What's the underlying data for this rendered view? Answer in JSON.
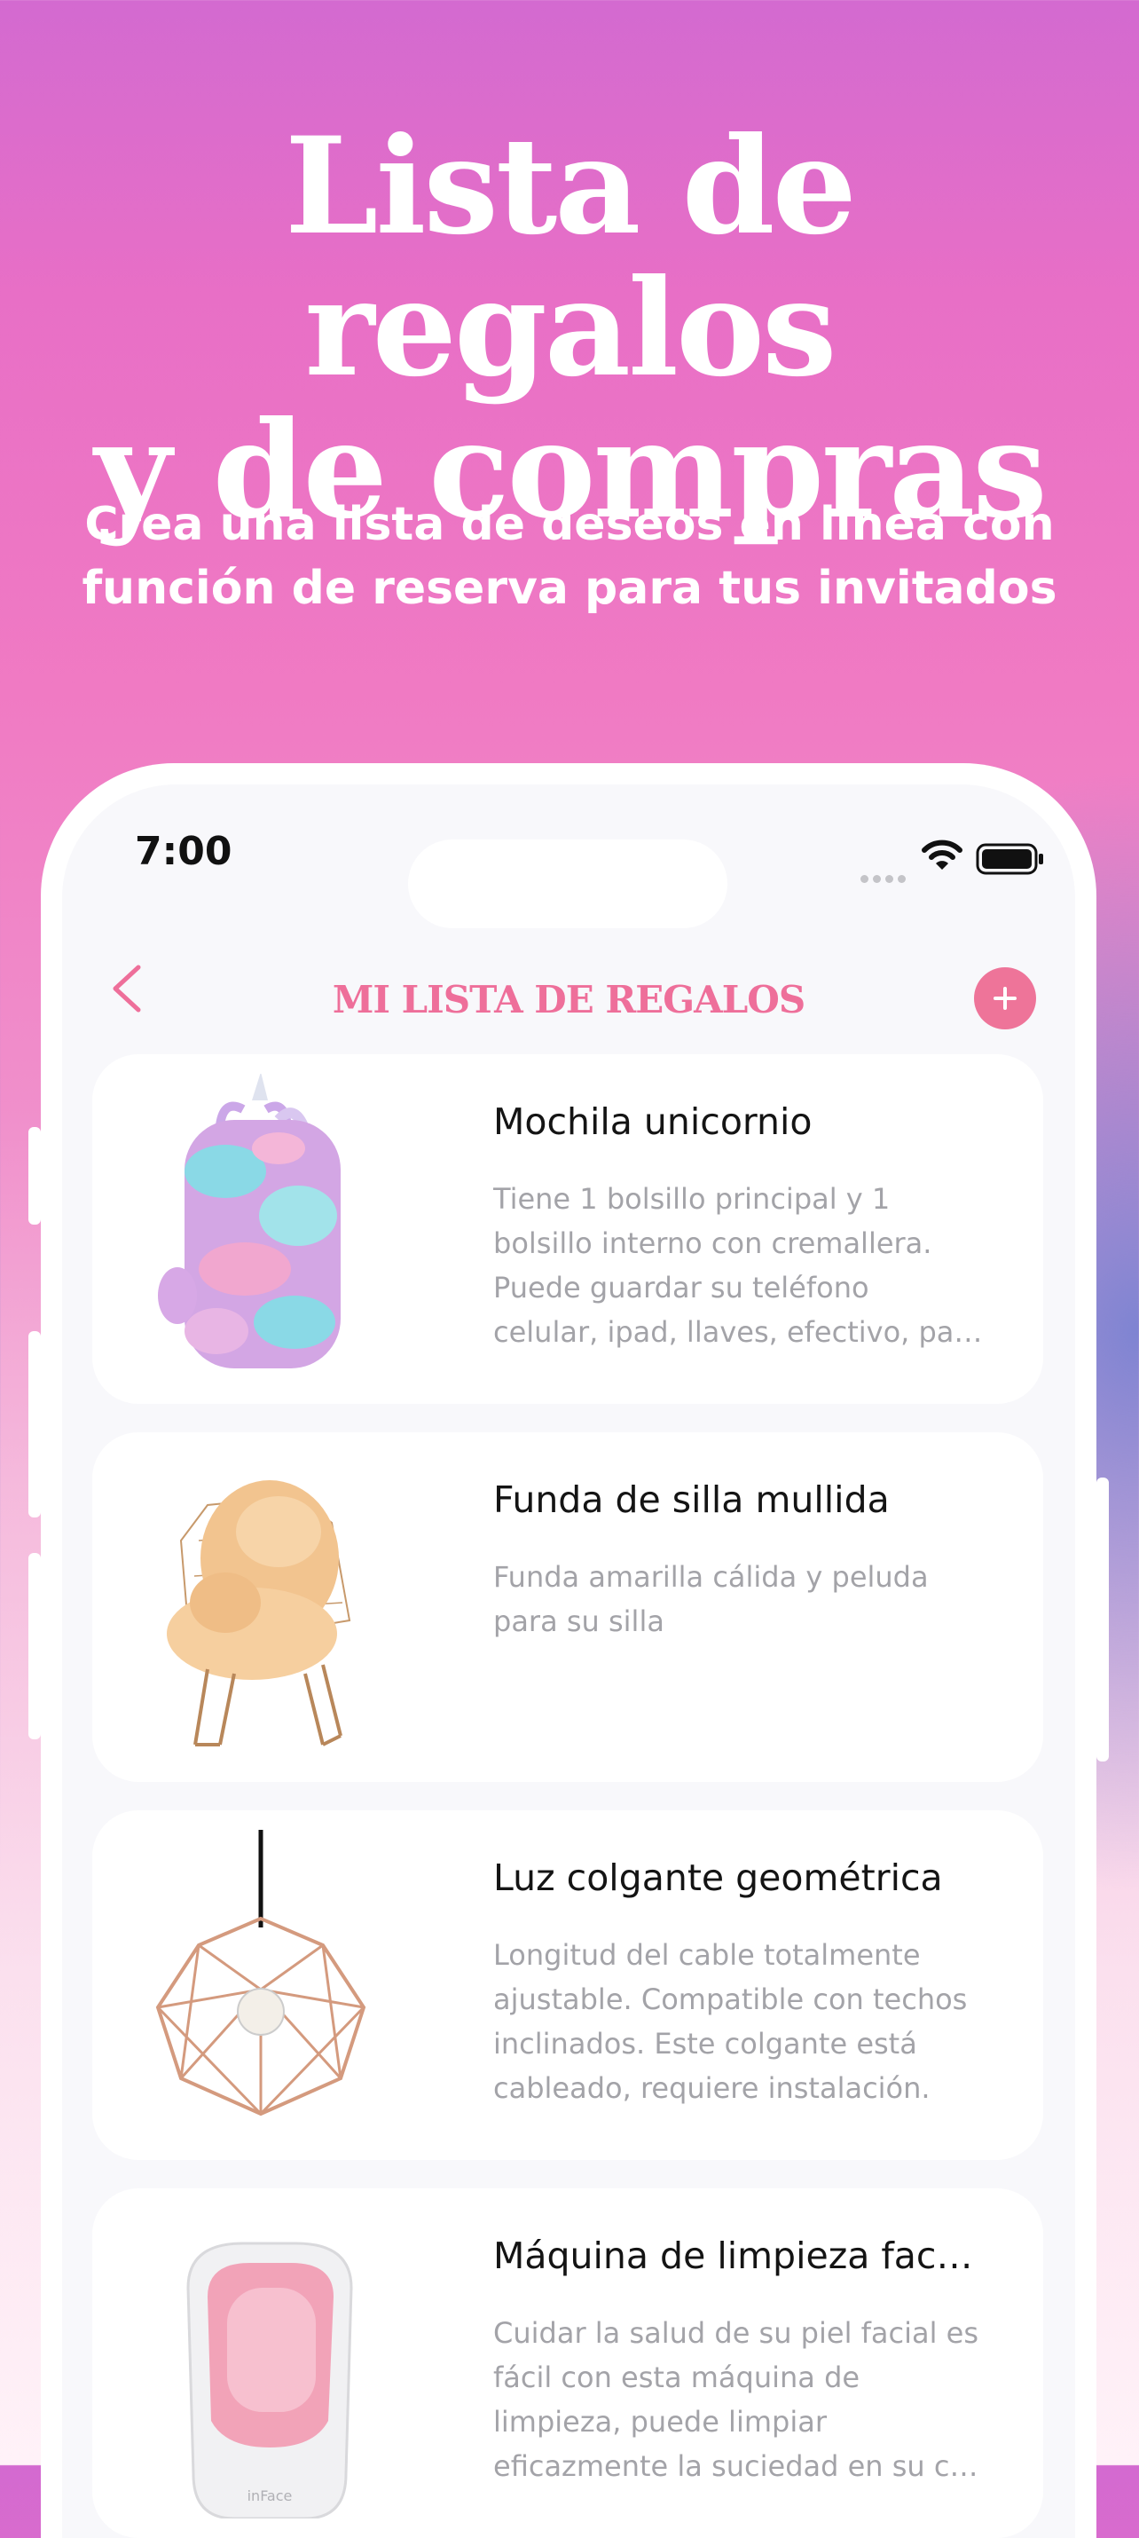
{
  "hero": {
    "title_line1": "Lista de regalos",
    "title_line2": "y de compras",
    "subtitle_line1": "Crea una lista de deseos en línea con",
    "subtitle_line2": "función de reserva para tus invitados"
  },
  "status_bar": {
    "time": "7:00"
  },
  "nav": {
    "title": "MI LISTA DE REGALOS",
    "back_icon": "chevron-left-icon",
    "add_icon": "plus-icon"
  },
  "colors": {
    "accent": "#ee7499",
    "title_pink": "#ee6f9a",
    "description_gray": "#a3a3a8"
  },
  "items": [
    {
      "title": "Mochila unicornio",
      "description": " Tiene 1 bolsillo principal y 1\nbolsillo interno con cremallera.\nPuede guardar su teléfono\ncelular, ipad, llaves, efectivo, pa…",
      "image": "unicorn-backpack"
    },
    {
      "title": "Funda de silla mullida",
      "description": "Funda amarilla cálida y peluda\npara su silla",
      "image": "fluffy-chair"
    },
    {
      "title": "Luz colgante geométrica",
      "description": "Longitud del cable totalmente\najustable. Compatible con techos\ninclinados. Este colgante está\ncableado, requiere instalación.",
      "image": "geometric-pendant-light"
    },
    {
      "title": "Máquina de limpieza fac…",
      "description": "Cuidar la salud de su piel facial es\nfácil con esta máquina de\nlimpieza, puede limpiar\neficazmente la suciedad en su c…",
      "image": "facial-cleansing-machine",
      "image_brand": "inFace"
    }
  ]
}
